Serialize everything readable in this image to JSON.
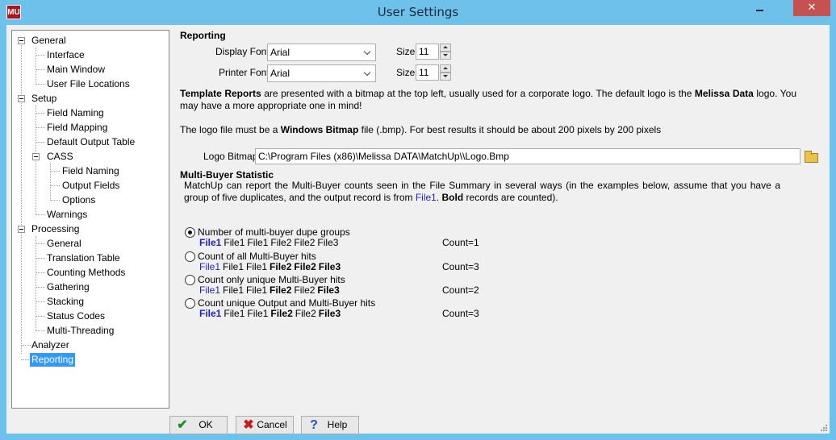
{
  "window": {
    "title": "User Settings",
    "app_icon_text": "MU",
    "close_glyph": "✕"
  },
  "tree": {
    "items": [
      {
        "label": "General"
      },
      {
        "label": "Interface"
      },
      {
        "label": "Main Window"
      },
      {
        "label": "User File Locations"
      },
      {
        "label": "Setup"
      },
      {
        "label": "Field Naming"
      },
      {
        "label": "Field Mapping"
      },
      {
        "label": "Default Output Table"
      },
      {
        "label": "CASS"
      },
      {
        "label": "Field Naming"
      },
      {
        "label": "Output Fields"
      },
      {
        "label": "Options"
      },
      {
        "label": "Warnings"
      },
      {
        "label": "Processing"
      },
      {
        "label": "General"
      },
      {
        "label": "Translation Table"
      },
      {
        "label": "Counting Methods"
      },
      {
        "label": "Gathering"
      },
      {
        "label": "Stacking"
      },
      {
        "label": "Status Codes"
      },
      {
        "label": "Multi-Threading"
      },
      {
        "label": "Analyzer"
      },
      {
        "label": "Reporting",
        "selected": true
      }
    ]
  },
  "reporting": {
    "heading": "Reporting",
    "display_font_label": "Display Font:",
    "display_font_value": "Arial",
    "printer_font_label": "Printer Font:",
    "printer_font_value": "Arial",
    "size_label": "Size:",
    "display_size": "11",
    "printer_size": "11",
    "template_text": {
      "b1": "Template Reports",
      "t1": " are presented with a bitmap at the top left, usually used for a corporate logo. The default logo is the ",
      "b2": "Melissa Data",
      "t2": " logo. You may have a more appropriate one in mind!"
    },
    "logo_text": {
      "t1": "The logo file must be a ",
      "b1": "Windows Bitmap",
      "t2": " file (.bmp). For best results it should be about 200 pixels by 200 pixels"
    },
    "logo_bitmap_label": "Logo Bitmap:",
    "logo_bitmap_value": "C:\\Program Files (x86)\\Melissa DATA\\MatchUp\\\\Logo.Bmp"
  },
  "multibuyer": {
    "heading": "Multi-Buyer Statistic",
    "desc": {
      "t1": "MatchUp can report the Multi-Buyer counts seen in the File Summary in several ways (in the examples below, assume that you have a group of five duplicates, and the output record is from ",
      "blue": "File1",
      "t2": ". ",
      "bold": "Bold",
      "t3": " records are counted)."
    },
    "options": [
      {
        "label": "Number of multi-buyer dupe groups",
        "checked": true,
        "files": [
          "File1",
          "File1",
          "File1",
          "File2",
          "File2",
          "File3"
        ],
        "count": "Count=1"
      },
      {
        "label": "Count of all Multi-Buyer hits",
        "checked": false,
        "files": [
          "File1",
          "File1",
          "File1",
          "File2",
          "File2",
          "File3"
        ],
        "count": "Count=3"
      },
      {
        "label": "Count only unique Multi-Buyer hits",
        "checked": false,
        "files": [
          "File1",
          "File1",
          "File1",
          "File2",
          "File2",
          "File3"
        ],
        "count": "Count=2"
      },
      {
        "label": "Count unique Output and Multi-Buyer hits",
        "checked": false,
        "files": [
          "File1",
          "File1",
          "File1",
          "File2",
          "File2",
          "File3"
        ],
        "count": "Count=3"
      }
    ]
  },
  "buttons": {
    "ok": "OK",
    "cancel": "Cancel",
    "help": "Help",
    "ok_icon": "✔",
    "cancel_icon": "✖",
    "help_icon": "?"
  },
  "colors": {
    "titlebar": "#6ec1ea",
    "selection": "#3399ff",
    "file_blue": "#1f1fbf",
    "close": "#c75050"
  }
}
